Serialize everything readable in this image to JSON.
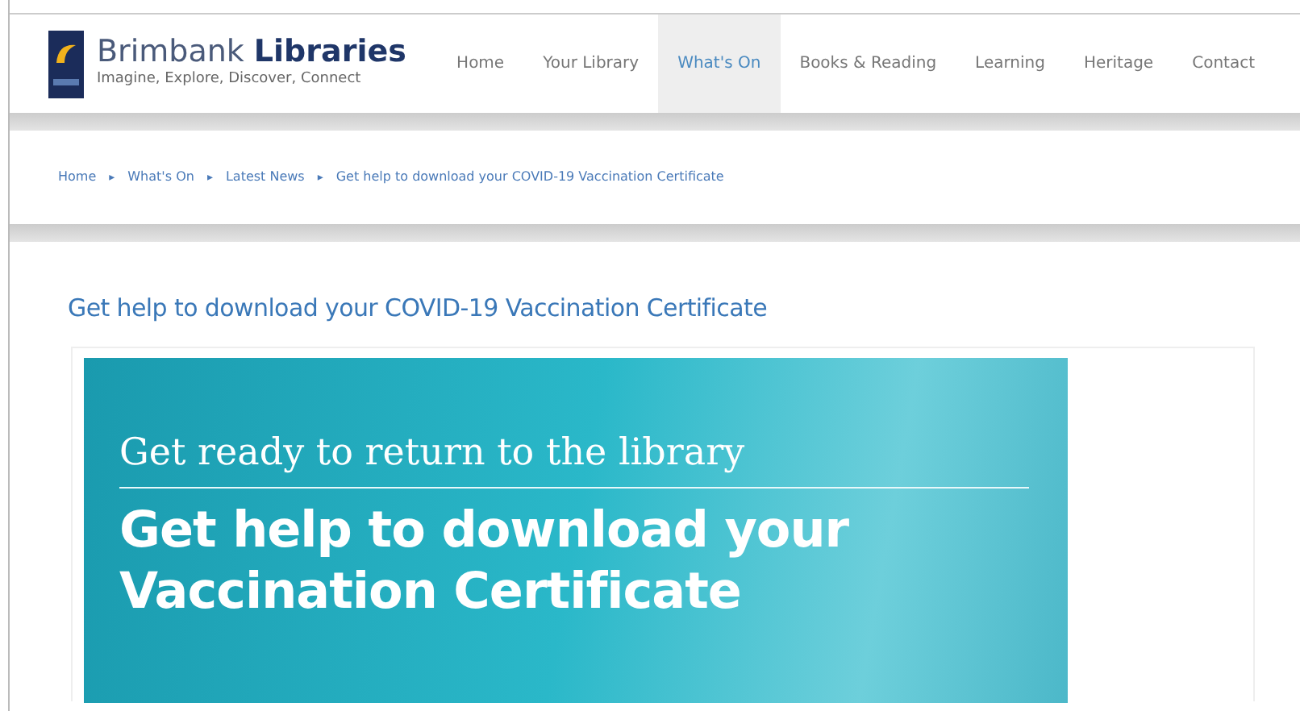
{
  "header": {
    "brand": "Brimbank",
    "brand_bold": "Libraries",
    "tagline": "Imagine, Explore, Discover, Connect"
  },
  "nav": [
    {
      "label": "Home",
      "selected": false
    },
    {
      "label": "Your Library",
      "selected": false
    },
    {
      "label": "What's On",
      "selected": true
    },
    {
      "label": "Books & Reading",
      "selected": false
    },
    {
      "label": "Learning",
      "selected": false
    },
    {
      "label": "Heritage",
      "selected": false
    },
    {
      "label": "Contact",
      "selected": false
    }
  ],
  "breadcrumb": {
    "separator": "▸",
    "items": [
      "Home",
      "What's On",
      "Latest News",
      "Get help to download your COVID-19 Vaccination Certificate"
    ]
  },
  "page_title": "Get help to download your COVID-19 Vaccination Certificate",
  "banner": {
    "kicker": "Get ready to return to the library",
    "headline": "Get help to download your Vaccination Certificate"
  }
}
